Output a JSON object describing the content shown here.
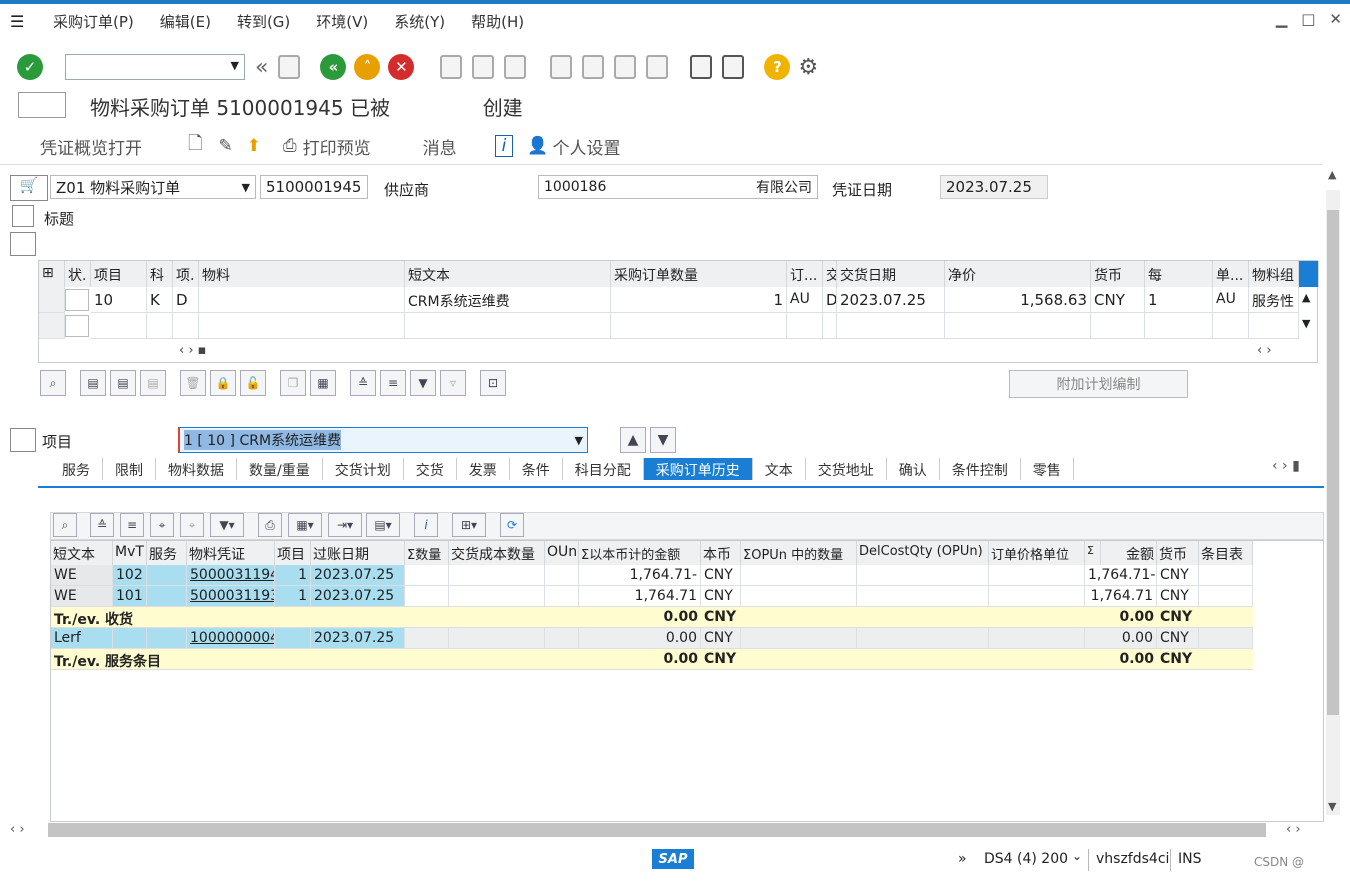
{
  "menu": [
    "采购订单(P)",
    "编辑(E)",
    "转到(G)",
    "环境(V)",
    "系统(Y)",
    "帮助(H)"
  ],
  "window": {
    "min": "▁",
    "max": "□",
    "close": "✕"
  },
  "title": "物料采购订单 5100001945 已被",
  "title_suffix": "创建",
  "appbar": {
    "overview": "凭证概览打开",
    "print_preview": "打印预览",
    "messages": "消息",
    "personal": "个人设置"
  },
  "header": {
    "doc_type": "Z01 物料采购订单",
    "po_number": "5100001945",
    "vendor_label": "供应商",
    "vendor_value": "1000186",
    "vendor_suffix": "有限公司",
    "date_label": "凭证日期",
    "date_value": "2023.07.25",
    "heading": "标题"
  },
  "items_table": {
    "headers": [
      "状.",
      "项目",
      "科",
      "项.",
      "物料",
      "短文本",
      "采购订单数量",
      "订...",
      "交",
      "交货日期",
      "净价",
      "货币",
      "每",
      "单...",
      "物料组"
    ],
    "rows": [
      [
        "",
        "10",
        "K",
        "D",
        "",
        "CRM系统运维费",
        "1",
        "AU",
        "D",
        "2023.07.25",
        "1,568.63",
        "CNY",
        "1",
        "AU",
        "服务性"
      ]
    ]
  },
  "additional_planning": "附加计划编制",
  "item_selector": {
    "label": "项目",
    "value": "1 [ 10 ] CRM系统运维费"
  },
  "tabs": [
    "服务",
    "限制",
    "物料数据",
    "数量/重量",
    "交货计划",
    "交货",
    "发票",
    "条件",
    "科目分配",
    "采购订单历史",
    "文本",
    "交货地址",
    "确认",
    "条件控制",
    "零售"
  ],
  "active_tab": "采购订单历史",
  "history": {
    "headers": [
      "短文本",
      "MvT",
      "服务",
      "物料凭证",
      "项目",
      "过账日期",
      "Σ数量",
      "交货成本数量",
      "OUn",
      "Σ以本币计的金额",
      "本币",
      "ΣOPUn 中的数量",
      "DelCostQty (OPUn)",
      "订单价格单位",
      "Σ",
      "金额",
      "货币",
      "条目表"
    ],
    "rows": [
      {
        "short": "WE",
        "mvt": "102",
        "doc": "5000031194",
        "item": "1",
        "date": "2023.07.25",
        "amount_lc": "1,764.71-",
        "lc": "CNY",
        "amount": "1,764.71-",
        "cur": "CNY",
        "type": "data"
      },
      {
        "short": "WE",
        "mvt": "101",
        "doc": "5000031193",
        "item": "1",
        "date": "2023.07.25",
        "amount_lc": "1,764.71",
        "lc": "CNY",
        "amount": "1,764.71",
        "cur": "CNY",
        "type": "data"
      },
      {
        "short": "Tr./ev. 收货",
        "amount_lc": "0.00",
        "lc": "CNY",
        "amount": "0.00",
        "cur": "CNY",
        "type": "sum"
      },
      {
        "short": "Lerf",
        "mvt": "",
        "doc": "1000000004",
        "item": "",
        "date": "2023.07.25",
        "amount_lc": "0.00",
        "lc": "CNY",
        "amount": "0.00",
        "cur": "CNY",
        "type": "data2"
      },
      {
        "short": "Tr./ev. 服务条目",
        "amount_lc": "0.00",
        "lc": "CNY",
        "amount": "0.00",
        "cur": "CNY",
        "type": "sum"
      }
    ]
  },
  "status": {
    "sap": "SAP",
    "system": "DS4 (4) 200",
    "server": "vhszfds4ci",
    "mode": "INS",
    "watermark": "CSDN @"
  },
  "colors": {
    "accent": "#1a7fd4",
    "cell_blue": "#a8def0",
    "sum_yellow": "#fffcd0"
  }
}
